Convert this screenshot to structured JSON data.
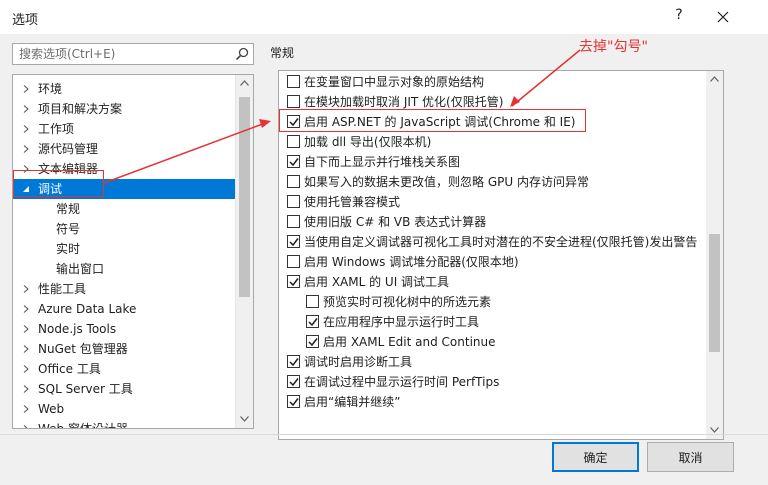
{
  "window": {
    "title": "选项",
    "help_label": "?"
  },
  "search": {
    "placeholder": "搜索选项(Ctrl+E)"
  },
  "tree": {
    "items": [
      {
        "label": "环境",
        "expanded": false
      },
      {
        "label": "项目和解决方案",
        "expanded": false
      },
      {
        "label": "工作项",
        "expanded": false
      },
      {
        "label": "源代码管理",
        "expanded": false
      },
      {
        "label": "文本编辑器",
        "expanded": false
      },
      {
        "label": "调试",
        "expanded": true,
        "selected": true
      },
      {
        "label": "常规",
        "child": true
      },
      {
        "label": "符号",
        "child": true
      },
      {
        "label": "实时",
        "child": true
      },
      {
        "label": "输出窗口",
        "child": true
      },
      {
        "label": "性能工具",
        "expanded": false
      },
      {
        "label": "Azure Data Lake",
        "expanded": false
      },
      {
        "label": "Node.js Tools",
        "expanded": false
      },
      {
        "label": "NuGet 包管理器",
        "expanded": false
      },
      {
        "label": "Office 工具",
        "expanded": false
      },
      {
        "label": "SQL Server 工具",
        "expanded": false
      },
      {
        "label": "Web",
        "expanded": false
      },
      {
        "label": "Web 窗体设计器",
        "expanded": false
      }
    ]
  },
  "section": {
    "title": "常规"
  },
  "options": [
    {
      "label": "在变量窗口中显示对象的原始结构",
      "checked": false,
      "indent": 0
    },
    {
      "label": "在模块加载时取消 JIT 优化(仅限托管)",
      "checked": false,
      "indent": 0
    },
    {
      "label": "启用 ASP.NET 的 JavaScript 调试(Chrome 和 IE)",
      "checked": true,
      "indent": 0
    },
    {
      "label": "加载 dll 导出(仅限本机)",
      "checked": false,
      "indent": 0
    },
    {
      "label": "自下而上显示并行堆栈关系图",
      "checked": true,
      "indent": 0
    },
    {
      "label": "如果写入的数据未更改值，则忽略 GPU 内存访问异常",
      "checked": false,
      "indent": 0
    },
    {
      "label": "使用托管兼容模式",
      "checked": false,
      "indent": 0
    },
    {
      "label": "使用旧版 C# 和 VB 表达式计算器",
      "checked": false,
      "indent": 0
    },
    {
      "label": "当使用自定义调试器可视化工具时对潜在的不安全进程(仅限托管)发出警告",
      "checked": true,
      "indent": 0
    },
    {
      "label": "启用 Windows 调试堆分配器(仅限本地)",
      "checked": false,
      "indent": 0
    },
    {
      "label": "启用 XAML 的 UI 调试工具",
      "checked": true,
      "indent": 0
    },
    {
      "label": "预览实时可视化树中的所选元素",
      "checked": false,
      "indent": 1
    },
    {
      "label": "在应用程序中显示运行时工具",
      "checked": true,
      "indent": 1
    },
    {
      "label": "启用 XAML Edit and Continue",
      "checked": true,
      "indent": 1
    },
    {
      "label": "调试时启用诊断工具",
      "checked": true,
      "indent": 0
    },
    {
      "label": "在调试过程中显示运行时间 PerfTips",
      "checked": true,
      "indent": 0
    },
    {
      "label": "启用“编辑并继续”",
      "checked": true,
      "indent": 0
    }
  ],
  "annotation": {
    "text": "去掉\"勾号\"",
    "color": "#e53333"
  },
  "buttons": {
    "ok": "确定",
    "cancel": "取消"
  },
  "colors": {
    "selection": "#0078d7",
    "dialog_bg": "#f0f0f0"
  }
}
